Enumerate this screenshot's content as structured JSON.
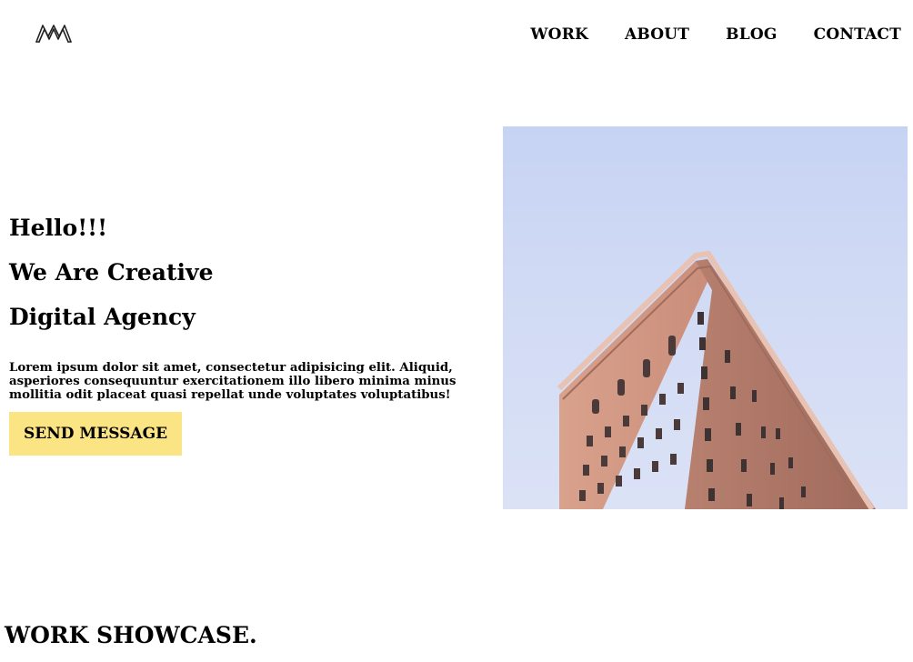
{
  "header": {
    "logo_icon": "m-logo-icon",
    "nav": [
      {
        "label": "WORK"
      },
      {
        "label": "ABOUT"
      },
      {
        "label": "BLOG"
      },
      {
        "label": "CONTACT"
      }
    ]
  },
  "hero": {
    "heading_lines": [
      "Hello!!!",
      "We Are Creative",
      "Digital Agency"
    ],
    "description": "Lorem ipsum dolor sit amet, consectetur adipisicing elit. Aliquid, asperiores consequuntur exercitationem illo libero minima minus mollitia odit placeat quasi repellat unde voluptates voluptatibus!",
    "button_label": "SEND MESSAGE",
    "button_color": "#fbe483",
    "image": "flatiron-building-photo"
  },
  "showcase": {
    "title": "WORK SHOWCASE."
  }
}
